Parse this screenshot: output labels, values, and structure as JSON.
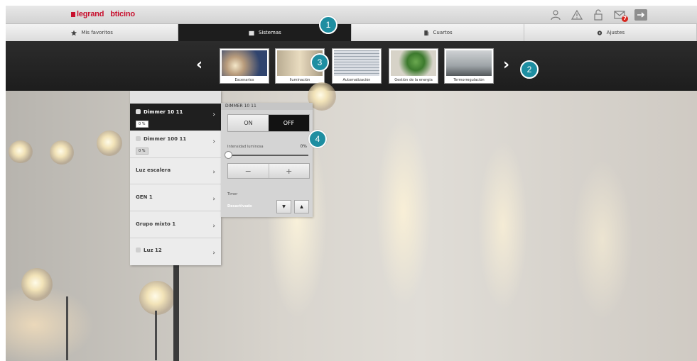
{
  "brand": {
    "primary": "legrand",
    "secondary": "bticino"
  },
  "header_icons": [
    {
      "name": "user-icon"
    },
    {
      "name": "alert-icon"
    },
    {
      "name": "lock-icon"
    },
    {
      "name": "mail-icon",
      "badge": "7"
    },
    {
      "name": "exit-icon"
    }
  ],
  "tabs": [
    {
      "label": "Mis favoritos",
      "icon": "star-icon",
      "active": false
    },
    {
      "label": "Sistemas",
      "icon": "systems-icon",
      "active": true
    },
    {
      "label": "Cuartos",
      "icon": "rooms-icon",
      "active": false
    },
    {
      "label": "Ajustes",
      "icon": "gear-icon",
      "active": false
    }
  ],
  "systems": [
    {
      "label": "Escenarios"
    },
    {
      "label": "Iluminación"
    },
    {
      "label": "Automatización"
    },
    {
      "label": "Gestión de la energía"
    },
    {
      "label": "Termorregulación"
    }
  ],
  "devices": [
    {
      "label": "Dimmer 10 11",
      "value": "0 %",
      "active": true
    },
    {
      "label": "Dimmer 100 11",
      "value": "0 %",
      "active": false
    },
    {
      "label": "Luz escalera",
      "active": false
    },
    {
      "label": "GEN 1",
      "active": false
    },
    {
      "label": "Grupo mixto 1",
      "active": false
    },
    {
      "label": "Luz 12",
      "active": false
    }
  ],
  "panel": {
    "title": "DIMMER 10 11",
    "on_label": "ON",
    "off_label": "OFF",
    "state": "OFF",
    "intensity_label": "Intensidad luminosa",
    "intensity_value": "0%",
    "intensity_fraction": 0,
    "minus_label": "−",
    "plus_label": "+",
    "timer_label": "Timer",
    "timer_value": "Desactivado",
    "timer_down": "▼",
    "timer_up": "▲"
  },
  "callouts": [
    "1",
    "2",
    "3",
    "4"
  ],
  "colors": {
    "accent": "#1e8ea1",
    "active_tab": "#1d1d1d",
    "brand_red": "#c8102e"
  }
}
